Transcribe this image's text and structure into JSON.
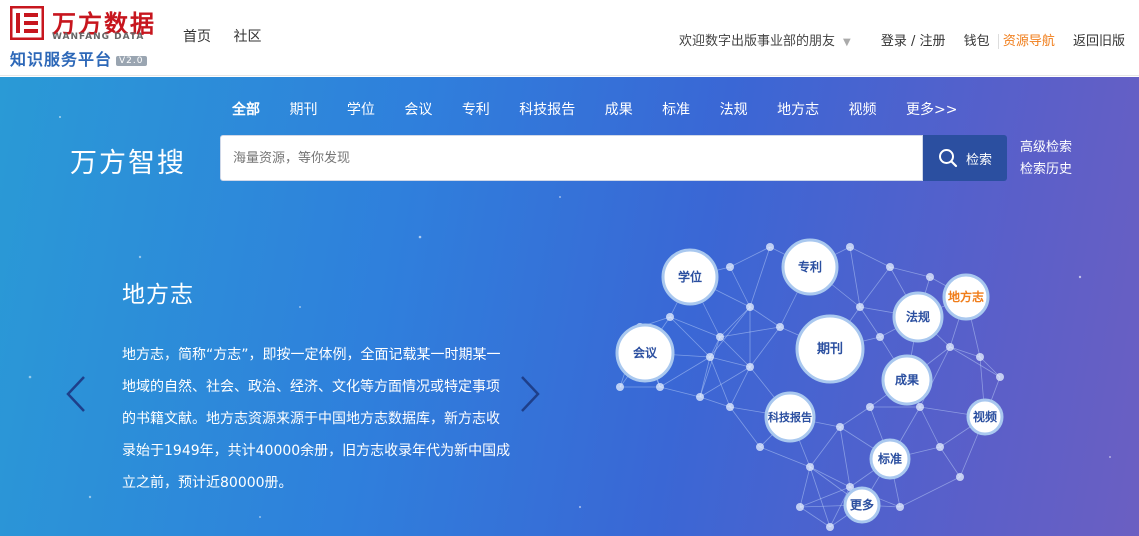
{
  "header": {
    "logo_cn": "万方数据",
    "logo_en": "WANFANG DATA",
    "logo_sub": "知识服务平台",
    "logo_ver": "V2.0",
    "nav": [
      "首页",
      "社区"
    ],
    "welcome": "欢迎数字出版事业部的朋友",
    "login": "登录 / 注册",
    "wallet": "钱包",
    "resource_nav": "资源导航",
    "old_version": "返回旧版"
  },
  "search": {
    "categories": [
      "全部",
      "期刊",
      "学位",
      "会议",
      "专利",
      "科技报告",
      "成果",
      "标准",
      "法规",
      "地方志",
      "视频",
      "更多>>"
    ],
    "title": "万方智搜",
    "placeholder": "海量资源，等你发现",
    "button": "检索",
    "advanced": "高级检索",
    "history": "检索历史"
  },
  "feature": {
    "title": "地方志",
    "description": "地方志，简称“方志”，即按一定体例，全面记载某一时期某一地域的自然、社会、政治、经济、文化等方面情况或特定事项的书籍文献。地方志资源来源于中国地方志数据库，新方志收录始于1949年，共计40000余册，旧方志收录年代为新中国成立之前，预计近80000册。"
  },
  "brain_nodes": [
    {
      "label": "学位",
      "active": false
    },
    {
      "label": "专利",
      "active": false
    },
    {
      "label": "地方志",
      "active": true
    },
    {
      "label": "法规",
      "active": false
    },
    {
      "label": "会议",
      "active": false
    },
    {
      "label": "期刊",
      "active": false
    },
    {
      "label": "成果",
      "active": false
    },
    {
      "label": "科技报告",
      "active": false
    },
    {
      "label": "视频",
      "active": false
    },
    {
      "label": "标准",
      "active": false
    },
    {
      "label": "更多",
      "active": false
    }
  ],
  "colors": {
    "brand_red": "#c7161e",
    "brand_blue": "#2d68b8",
    "accent_orange": "#f07d1a",
    "search_button": "#2b4fa0"
  }
}
